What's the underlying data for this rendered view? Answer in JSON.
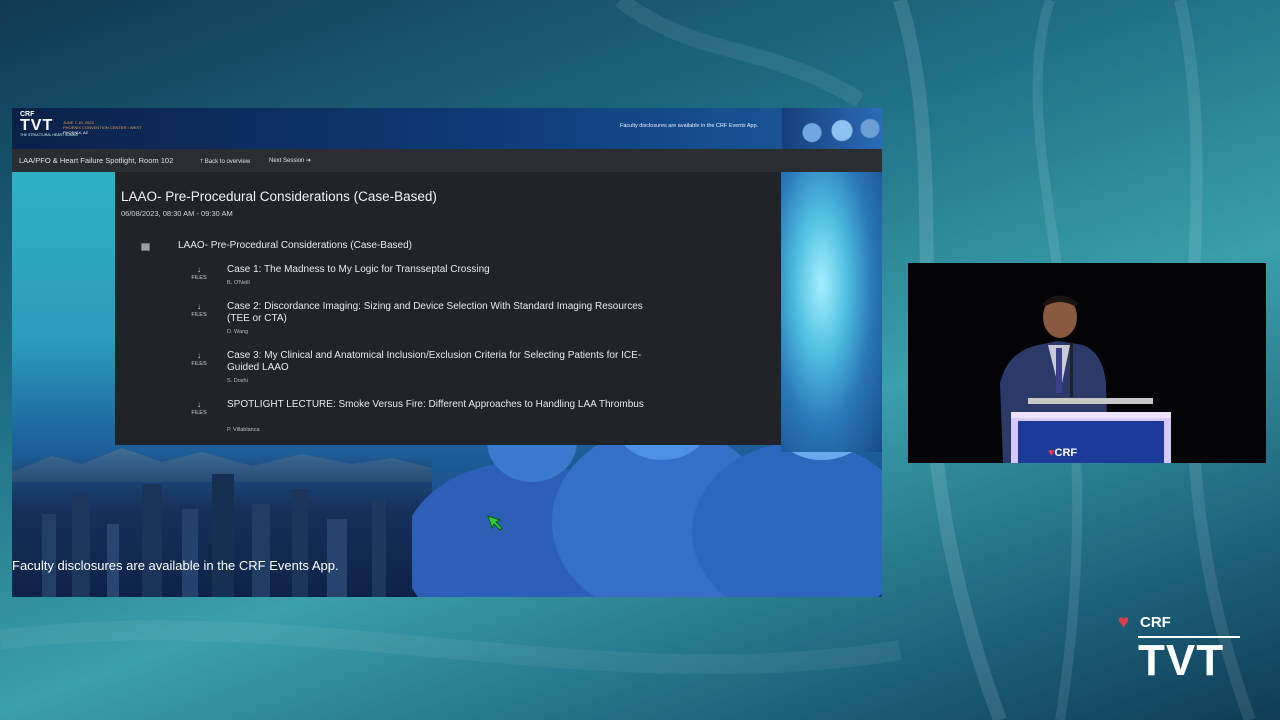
{
  "slide": {
    "header": {
      "brand_crf": "CRF",
      "brand_tvt": "TVT",
      "brand_sub": "THE STRUCTURAL HEART SUMMIT",
      "event_dates": "JUNE 7-10, 2023",
      "event_venue": "PHOENIX CONVENTION CENTER • WEST",
      "event_city": "PHOENIX, AZ",
      "disclosure": "Faculty disclosures are available in the CRF Events App."
    },
    "nav": {
      "room": "LAA/PFO & Heart Failure Spotlight, Room 102",
      "back": "Back to overview",
      "next": "Next Session"
    },
    "session": {
      "title": "LAAO- Pre-Procedural Considerations (Case-Based)",
      "time": "06/08/2023, 08:30 AM - 09:30 AM",
      "subsession_title": "LAAO- Pre-Procedural Considerations (Case-Based)",
      "files_label": "FILES",
      "talks": [
        {
          "title": "Case 1: The Madness to My Logic for Transseptal Crossing",
          "speaker": "B. O'Neill"
        },
        {
          "title": "Case 2: Discordance Imaging: Sizing and Device Selection With Standard Imaging Resources (TEE or CTA)",
          "speaker": "D. Wang"
        },
        {
          "title": "Case 3: My Clinical and Anatomical Inclusion/Exclusion Criteria for Selecting Patients for ICE-Guided LAAO",
          "speaker": "S. Doshi"
        },
        {
          "title": "SPOTLIGHT LECTURE: Smoke Versus Fire: Different Approaches to Handling LAA Thrombus",
          "speaker": "P. Villablanca"
        }
      ]
    },
    "overlay_disclosure": "Faculty disclosures are available in the CRF Events App."
  },
  "presenter": {
    "podium_logo": "CRF"
  },
  "brand": {
    "crf": "CRF",
    "tvt": "TVT"
  },
  "colors": {
    "panel_bg": "#202327",
    "navbar_bg": "#2a2d31",
    "cursor_green": "#2ecc40",
    "event_orange": "#f1a24c"
  }
}
